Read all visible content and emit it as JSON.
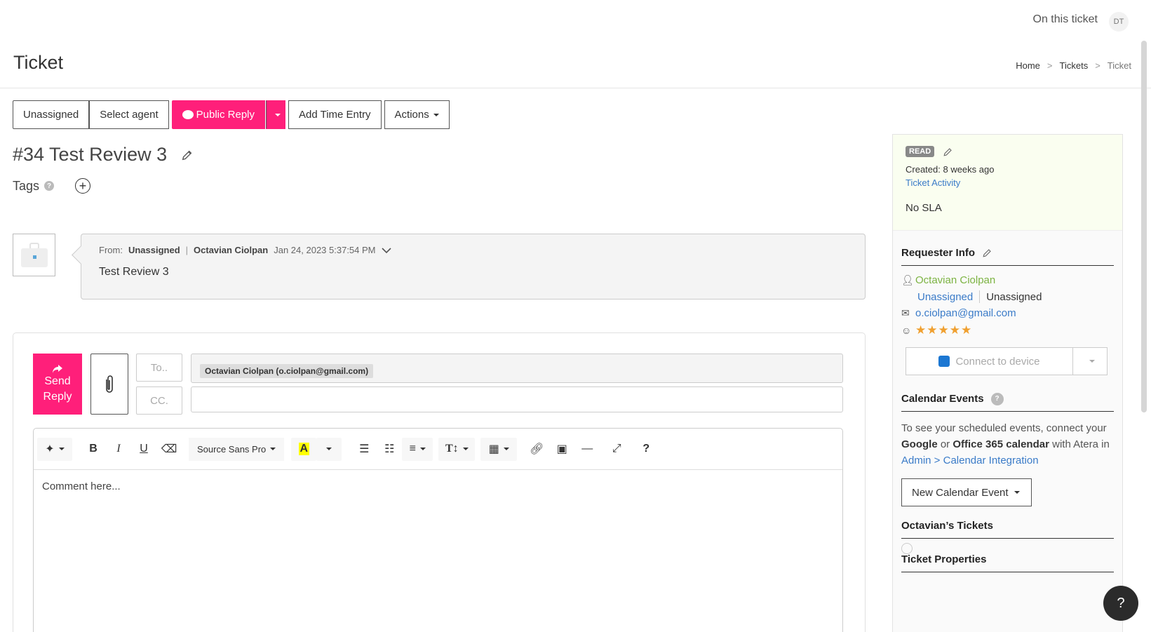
{
  "topbar": {
    "on_ticket": "On this ticket",
    "avatar_initials": "DT"
  },
  "page": {
    "title": "Ticket"
  },
  "breadcrumb": {
    "home": "Home",
    "tickets": "Tickets",
    "current": "Ticket",
    "separator": ">"
  },
  "toolbar": {
    "unassigned": "Unassigned",
    "select_agent": "Select agent",
    "public_reply": "Public Reply",
    "add_time_entry": "Add Time Entry",
    "actions": "Actions"
  },
  "ticket": {
    "title": "#34 Test Review 3",
    "tags_label": "Tags",
    "tags_help": "?"
  },
  "message": {
    "from_label": "From:",
    "from_value": "Unassigned",
    "separator": "|",
    "author": "Octavian Ciolpan",
    "timestamp": "Jan 24, 2023 5:37:54 PM",
    "body": "Test Review 3"
  },
  "reply": {
    "send_label_1": "Send",
    "send_label_2": "Reply",
    "to_label": "To..",
    "cc_label": "CC.",
    "to_chip": "Octavian Ciolpan (o.ciolpan@gmail.com)",
    "font_name": "Source Sans Pro",
    "placeholder": "Comment here..."
  },
  "sidebar": {
    "read_badge": "READ",
    "created": "Created: 8 weeks ago",
    "activity_link": "Ticket Activity",
    "sla": "No SLA",
    "requester_title": "Requester Info",
    "requester_name": "Octavian Ciolpan",
    "requester_org_link": "Unassigned",
    "requester_org": "Unassigned",
    "requester_email": "o.ciolpan@gmail.com",
    "stars": "★★★★★",
    "connect_label": "Connect to device",
    "calendar_title": "Calendar Events",
    "cal_help": "?",
    "cal_text_1": "To see your scheduled events, connect your ",
    "cal_google": "Google",
    "cal_or": " or ",
    "cal_office": "Office 365 calendar",
    "cal_text_2": " with Atera in ",
    "cal_link": "Admin > Calendar Integration",
    "new_cal_event": "New Calendar Event",
    "tickets_title": "Octavian’s Tickets",
    "properties_title": "Ticket Properties"
  },
  "help": {
    "label": "?"
  },
  "colors": {
    "accent": "#ff1f7a",
    "link": "#3a7bc8",
    "green": "#7cb342",
    "star": "#f0a030"
  }
}
